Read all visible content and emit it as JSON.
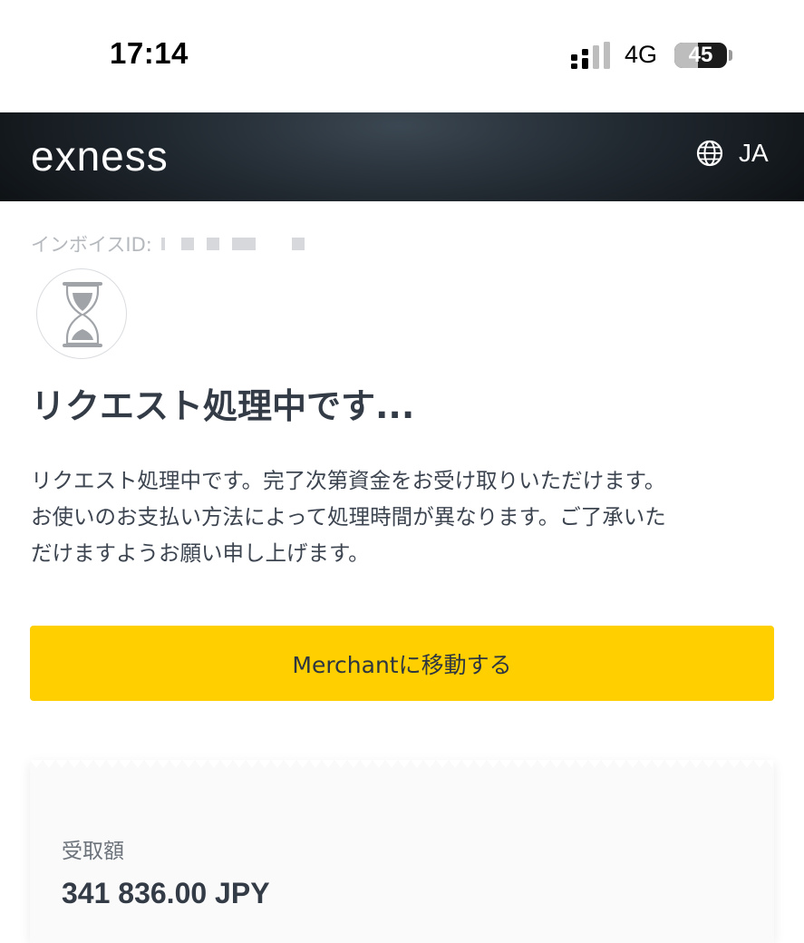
{
  "status_bar": {
    "time": "17:14",
    "network": "4G",
    "battery_level": "45",
    "battery_percent": 45
  },
  "header": {
    "logo": "exness",
    "language": "JA"
  },
  "page": {
    "invoice_label": "インボイスID:",
    "title": "リクエスト処理中です...",
    "description_lines": [
      "リクエスト処理中です。完了次第資金をお受け取りいただけます。",
      "お使いのお支払い方法によって処理時間が異なります。ご了承いた",
      "だけますようお願い申し上げます。"
    ],
    "merchant_button": "Merchantに移動する"
  },
  "receipt": {
    "amount_label": "受取額",
    "amount_value": "341 836.00 JPY"
  },
  "colors": {
    "accent": "#ffcf00",
    "header_dark": "#0d1114",
    "text_dark": "#333b46"
  }
}
